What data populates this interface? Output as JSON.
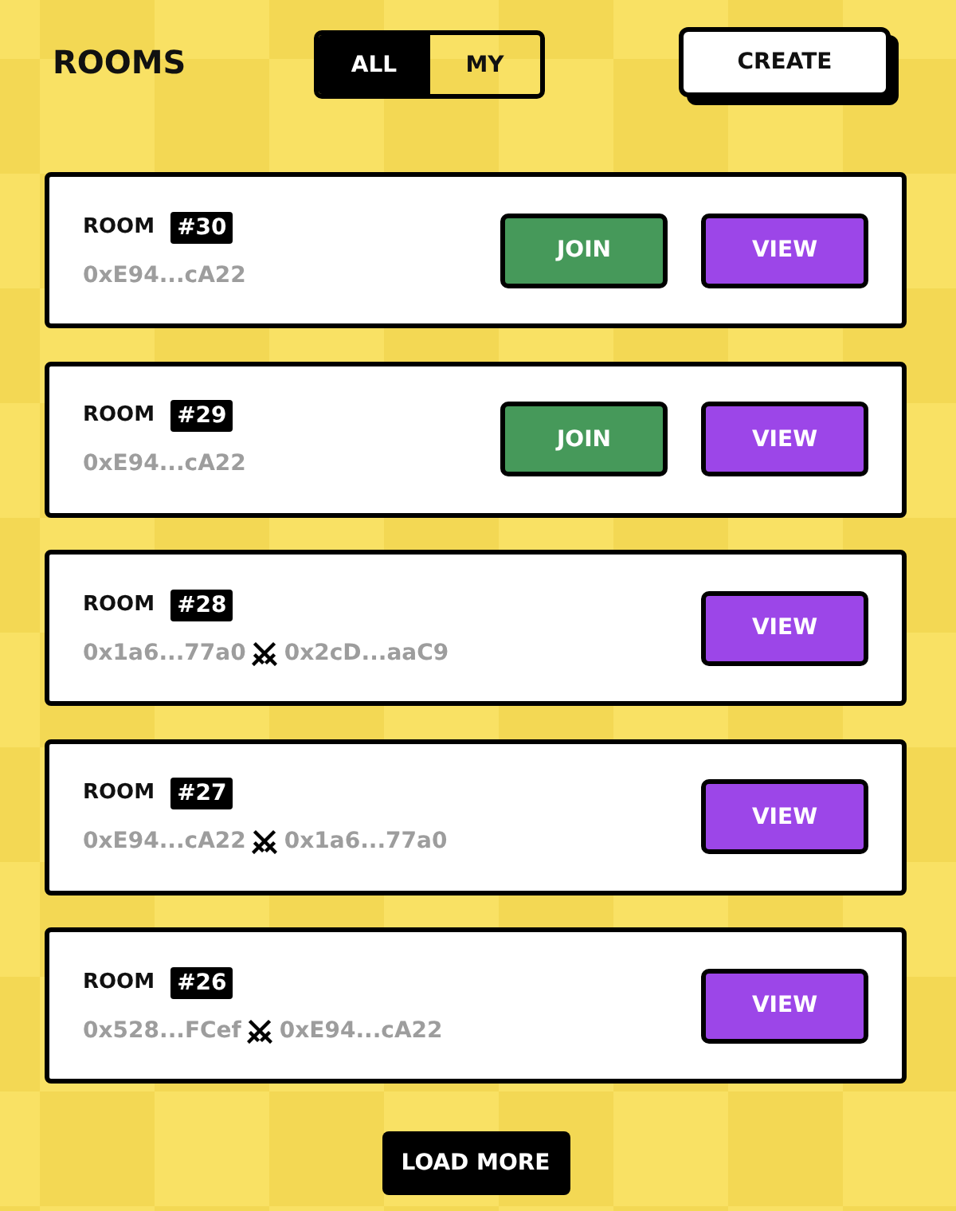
{
  "header": {
    "title": "ROOMS",
    "filter_tabs": [
      {
        "label": "ALL",
        "selected": true
      },
      {
        "label": "MY",
        "selected": false
      }
    ],
    "create_button": "CREATE"
  },
  "rooms": [
    {
      "label": "ROOM",
      "number": "#30",
      "players": [
        "0xE94...cA22"
      ],
      "actions": [
        {
          "kind": "join",
          "label": "JOIN"
        },
        {
          "kind": "view",
          "label": "VIEW"
        }
      ]
    },
    {
      "label": "ROOM",
      "number": "#29",
      "players": [
        "0xE94...cA22"
      ],
      "actions": [
        {
          "kind": "join",
          "label": "JOIN"
        },
        {
          "kind": "view",
          "label": "VIEW"
        }
      ]
    },
    {
      "label": "ROOM",
      "number": "#28",
      "players": [
        "0x1a6...77a0",
        "0x2cD...aaC9"
      ],
      "actions": [
        {
          "kind": "view",
          "label": "VIEW"
        }
      ]
    },
    {
      "label": "ROOM",
      "number": "#27",
      "players": [
        "0xE94...cA22",
        "0x1a6...77a0"
      ],
      "actions": [
        {
          "kind": "view",
          "label": "VIEW"
        }
      ]
    },
    {
      "label": "ROOM",
      "number": "#26",
      "players": [
        "0x528...FCef",
        "0xE94...cA22"
      ],
      "actions": [
        {
          "kind": "view",
          "label": "VIEW"
        }
      ]
    }
  ],
  "load_more": "LOAD MORE"
}
